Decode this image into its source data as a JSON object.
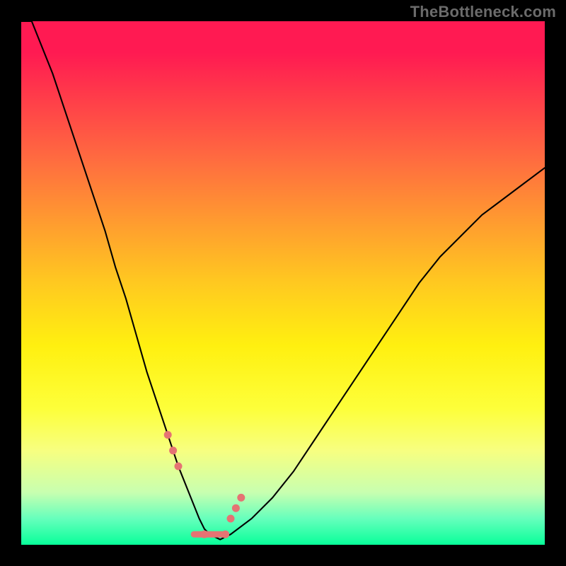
{
  "watermark": "TheBottleneck.com",
  "colors": {
    "gradient_top": "#ff1a52",
    "gradient_bottom": "#08ff9a",
    "curve": "#000000",
    "marker": "#e57373",
    "frame": "#000000"
  },
  "chart_data": {
    "type": "line",
    "title": "",
    "xlabel": "",
    "ylabel": "",
    "xlim": [
      0,
      100
    ],
    "ylim": [
      0,
      100
    ],
    "grid": false,
    "legend": false,
    "x": [
      0,
      2,
      4,
      6,
      8,
      10,
      12,
      14,
      16,
      18,
      20,
      22,
      24,
      26,
      28,
      30,
      32,
      34,
      35,
      36,
      38,
      40,
      44,
      48,
      52,
      56,
      60,
      64,
      68,
      72,
      76,
      80,
      84,
      88,
      92,
      96,
      100
    ],
    "values": [
      100,
      100,
      95,
      90,
      84,
      78,
      72,
      66,
      60,
      53,
      47,
      40,
      33,
      27,
      21,
      15,
      10,
      5,
      3,
      2,
      1,
      2,
      5,
      9,
      14,
      20,
      26,
      32,
      38,
      44,
      50,
      55,
      59,
      63,
      66,
      69,
      72
    ],
    "markers": {
      "x": [
        28,
        29,
        30,
        35,
        39,
        40,
        41,
        42
      ],
      "y": [
        21,
        18,
        15,
        2,
        2,
        5,
        7,
        9
      ]
    },
    "knee_segment": {
      "x": [
        33,
        39
      ],
      "y": [
        2,
        2
      ]
    },
    "annotations": [],
    "notes": "Bottleneck-style V curve; axes unlabeled in source image. Values estimated from pixel positions."
  }
}
